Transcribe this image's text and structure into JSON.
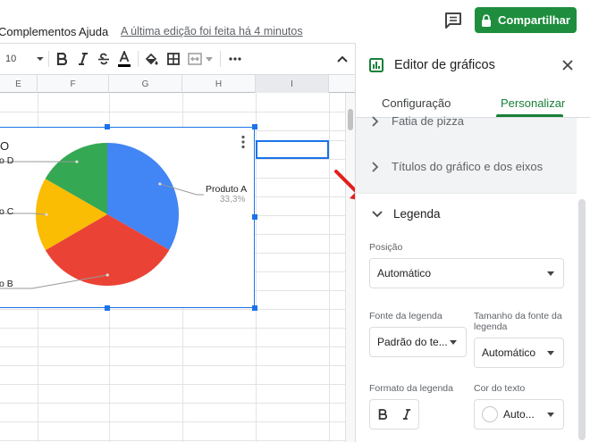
{
  "menu": {
    "complementos": "Complementos",
    "ajuda": "Ajuda",
    "last_edit": "A última edição foi feita há 4 minutos",
    "share": "Compartilhar"
  },
  "toolbar": {
    "font_size": "10"
  },
  "sheet": {
    "columns": [
      "E",
      "F",
      "G",
      "H",
      "I"
    ]
  },
  "chart_data": {
    "type": "pie",
    "title": "O",
    "categories": [
      "Produto A",
      "Produto B",
      "Produto C",
      "Produto D"
    ],
    "values": [
      33.3,
      33.3,
      16.7,
      16.7
    ],
    "visible_labels": [
      "Produto A",
      "o B",
      "o C",
      "o D"
    ],
    "data_labels": [
      "33,3%"
    ],
    "colors": [
      "#4285f4",
      "#ea4335",
      "#fbbc04",
      "#34a853"
    ]
  },
  "panel": {
    "title": "Editor de gráficos",
    "tabs": [
      "Configuração",
      "Personalizar"
    ],
    "active_tab": "Personalizar",
    "sections": {
      "pie_slice": "Fatia de pizza",
      "titles": "Títulos do gráfico e dos eixos",
      "legend": "Legenda"
    },
    "legend": {
      "position_label": "Posição",
      "position_value": "Automático",
      "font_label": "Fonte da legenda",
      "font_value": "Padrão do te...",
      "font_size_label": "Tamanho da fonte da legenda",
      "font_size_value": "Automático",
      "format_label": "Formato da legenda",
      "text_color_label": "Cor do texto",
      "text_color_value": "Auto..."
    }
  },
  "colors": {
    "accent_green": "#1e8e3e",
    "selection_blue": "#1a73e8",
    "arrow_red": "#e41e1e"
  }
}
